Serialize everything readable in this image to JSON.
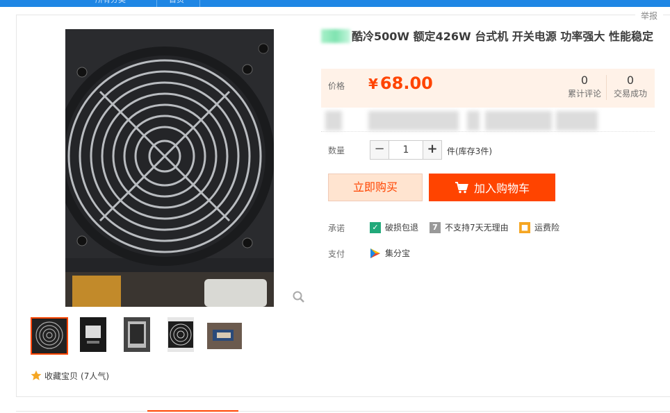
{
  "topbar": {
    "tabs": [
      "所有分类",
      "首页"
    ]
  },
  "report_label": "举报",
  "product": {
    "title": "酷冷500W 额定426W 台式机 开关电源 功率强大 性能稳定",
    "price_label": "价格",
    "currency": "¥",
    "price": "68.00",
    "reviews": {
      "count": "0",
      "label": "累计评论"
    },
    "sales": {
      "count": "0",
      "label": "交易成功"
    }
  },
  "quantity": {
    "label": "数量",
    "value": "1",
    "minus": "−",
    "plus": "+",
    "stock_text": "件(库存3件)"
  },
  "actions": {
    "buy_now": "立即购买",
    "add_to_cart": "加入购物车"
  },
  "promise": {
    "label": "承诺",
    "items": [
      {
        "icon": "shield-icon",
        "text": "破损包退",
        "color": "#21a97a"
      },
      {
        "icon": "seven-icon",
        "text": "不支持7天无理由",
        "color": "#999999"
      },
      {
        "icon": "freight-icon",
        "text": "运费险",
        "color": "#f5a623"
      }
    ]
  },
  "payment": {
    "label": "支付",
    "method": "集分宝"
  },
  "favorite": {
    "text": "收藏宝贝",
    "popularity": "(7人气)"
  },
  "colors": {
    "accent": "#ff4400",
    "price_bg": "#fff2e8",
    "topbar": "#1f86e4"
  }
}
